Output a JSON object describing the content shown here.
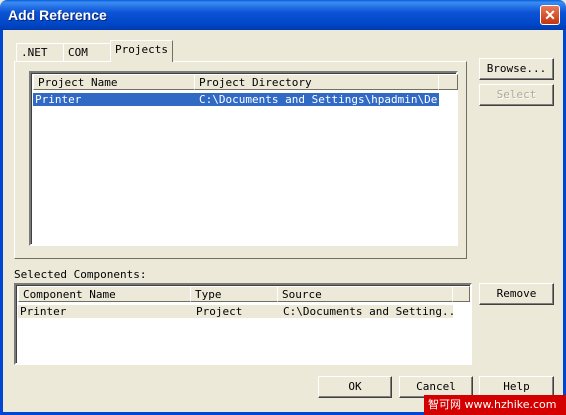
{
  "window": {
    "title": "Add Reference",
    "close": "✕"
  },
  "tabs": [
    {
      "label": ".NET"
    },
    {
      "label": "COM"
    },
    {
      "label": "Projects"
    }
  ],
  "projects": {
    "columns": [
      "Project Name",
      "Project Directory"
    ],
    "rows": [
      {
        "name": "Printer",
        "directory": "C:\\Documents and Settings\\hpadmin\\De..."
      }
    ]
  },
  "buttons": {
    "browse": "Browse...",
    "select": "Select",
    "remove": "Remove",
    "ok": "OK",
    "cancel": "Cancel",
    "help": "Help"
  },
  "selected": {
    "label": "Selected Components:",
    "columns": [
      "Component Name",
      "Type",
      "Source"
    ],
    "rows": [
      {
        "name": "Printer",
        "type": "Project",
        "source": "C:\\Documents and Setting..."
      }
    ]
  },
  "watermark": "智可网  www.hzhike.com",
  "colors": {
    "selection": "#316ac5",
    "titlebar": "#0054e3",
    "face": "#ece9d8"
  }
}
